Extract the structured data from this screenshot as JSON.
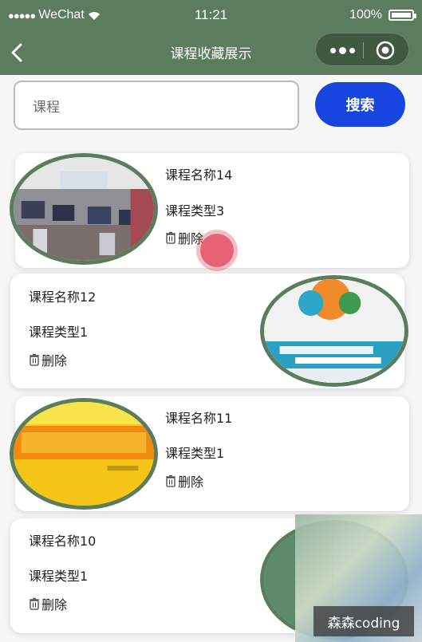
{
  "status_bar": {
    "carrier": "WeChat",
    "time": "11:21",
    "battery_percent": "100%"
  },
  "nav": {
    "title": "课程收藏展示"
  },
  "search": {
    "value": "课程",
    "button_label": "搜索"
  },
  "cards": [
    {
      "name": "课程名称14",
      "type": "课程类型3",
      "delete_label": "删除",
      "thumb": "photo-computer-lab"
    },
    {
      "name": "课程名称12",
      "type": "课程类型1",
      "delete_label": "删除",
      "thumb": "java-book-cover"
    },
    {
      "name": "课程名称11",
      "type": "课程类型1",
      "delete_label": "删除",
      "thumb": "exam-guide-cover"
    },
    {
      "name": "课程名称10",
      "type": "课程类型1",
      "delete_label": "删除",
      "thumb": "blurred-image"
    }
  ],
  "watermark": "森森coding",
  "colors": {
    "nav_green": "#5b7d5d",
    "search_button": "#1844e0",
    "thumb_border": "#5b7d5d",
    "tap_indicator": "#e0465f"
  }
}
